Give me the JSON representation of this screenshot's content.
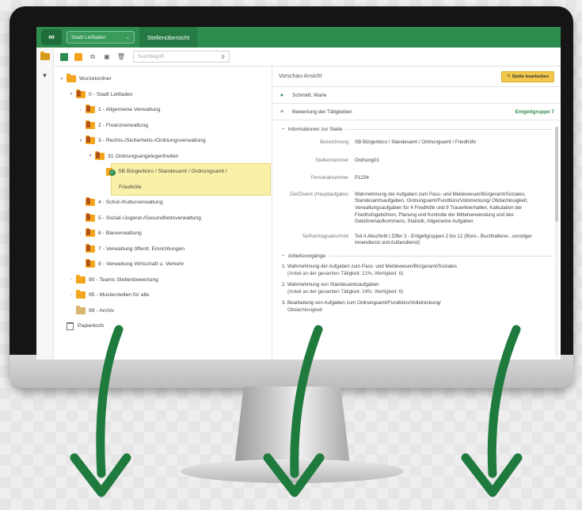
{
  "app": {
    "template_select": "Stadt Leitfaden",
    "active_tab": "Stellenübersicht",
    "search_placeholder": "Suchbegriff"
  },
  "tree": {
    "root": "Wurzelordner",
    "items": [
      {
        "label": "0 - Stadt Leitfaden"
      },
      {
        "label": "1 - Allgemeine Verwaltung"
      },
      {
        "label": "2 - Finanzverwaltung"
      },
      {
        "label": "3 - Rechts-/Sicherheits-/Ordnungsverwaltung"
      },
      {
        "label": "31 Ordnungsangelegenheiten"
      },
      {
        "label": "SB Bürgerbüro / Standesamt / Ordnungsamt /",
        "label2": "Friedhöfe"
      },
      {
        "label": "4 - Schul-/Kulturverwaltung"
      },
      {
        "label": "5 - Sozial-/Jugend-/Gesundheitsverwaltung"
      },
      {
        "label": "6 - Bauverwaltung"
      },
      {
        "label": "7 - Verwaltung öffentl. Einrichtungen"
      },
      {
        "label": "8 - Verwaltung Wirtschaft u. Verkehr"
      },
      {
        "label": "90 - Teams Stellenbewertung"
      },
      {
        "label": "95 - Musterstellen für alle"
      },
      {
        "label": "99 - Archiv"
      },
      {
        "label": "Papierkorb"
      }
    ]
  },
  "preview": {
    "title": "Vorschau-Ansicht",
    "edit_button": "Stelle bearbeiten",
    "person": "Schmidt, Marie",
    "bewertung_label": "Bewertung der Tätigkeiten",
    "entgeltgruppe": "Entgeltgruppe 7",
    "info_section": "Informationen zur Stelle",
    "fields": {
      "bezeichnung_label": "Bezeichnung",
      "bezeichnung_value": "SB Bürgerbüro / Standesamt / Ordnungsamt / Friedhöfe",
      "stellennummer_label": "Stellennummer",
      "stellennummer_value": "Ordnung01",
      "personalnummer_label": "Personalnummer",
      "personalnummer_value": "P1234",
      "zweck_label": "Ziel/Zweck (Hauptaufgabe)",
      "zweck_value": "Wahrnehmung der Aufgaben zum Pass- und Meldewesen/Bürgeramt/Soziales, Standesamtsaufgaben, Ordnungsamt/Fundbüro/Vollstreckung/ Obdachlosigkeit, Verwaltungsaufgaben für 4 Friedhöfe und 9 Trauerfeierhallen, Kalkulation der Friedhofsgebühren, Planung und Kontrolle der Mittelverwendung und des Gebührenaufkommens, Statistik, Allgemeine Aufgaben",
      "tarif_label": "Tarifvertragsabschnitt",
      "tarif_value": "Teil A Abschnitt I Ziffer 3 - Entgeltgruppen 2 bis 12 (Büro-, Buchhalterei-, sonstiger Innendienst und Außendienst)"
    },
    "arbeitsvorgaenge_section": "Arbeitsvorgänge",
    "vorgaenge": [
      {
        "title": "1. Wahrnehmung der Aufgaben zum Pass- und Meldewesen/Bürgeramt/Soziales",
        "sub": "(Anteil an der gesamten Tätigkeit: 21%, Wertigkeit: 6)"
      },
      {
        "title": "2. Wahrnehmung von Standesamtsaufgaben",
        "sub": "(Anteil an der gesamten Tätigkeit: 14%, Wertigkeit: 6)"
      },
      {
        "title": "3. Bearbeitung von Aufgaben zum Ordnungsamt/Fundbüro/Vollstreckung/",
        "sub": "Obdachlosigkeit"
      }
    ]
  },
  "colors": {
    "brand_green": "#2e8c4f",
    "arrow_green": "#1f7a3e",
    "folder_orange": "#f3a51d",
    "selection_yellow": "#faf0a8",
    "edit_button_yellow": "#f2c94c"
  },
  "icons": [
    "owl-logo-icon",
    "chevron-down-icon",
    "search-icon",
    "filter-icon",
    "folder-icon",
    "trash-icon",
    "person-icon",
    "list-icon",
    "pencil-icon",
    "arrow-down-icon"
  ]
}
